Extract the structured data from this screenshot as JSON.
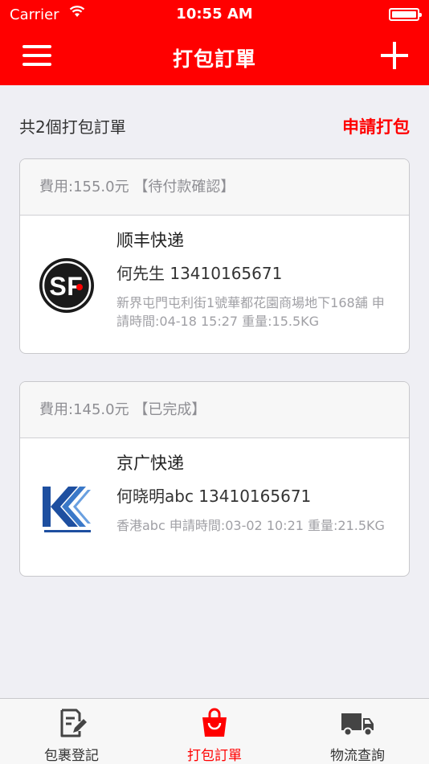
{
  "status_bar": {
    "carrier": "Carrier",
    "time": "10:55 AM"
  },
  "header": {
    "title": "打包訂單",
    "menu_icon": "hamburger-menu-icon",
    "add_icon": "plus-icon",
    "color": "#ff0000"
  },
  "summary": {
    "count_text": "共2個打包訂單",
    "apply_label": "申請打包"
  },
  "orders": [
    {
      "fee_status": "費用:155.0元 【待付款確認】",
      "courier": "顺丰快递",
      "contact": "何先生 13410165671",
      "detail": "新界屯門屯利街1號華都花園商場地下168舖 申請時間:04-18 15:27 重量:15.5KG",
      "logo": "sf-express-logo"
    },
    {
      "fee_status": "費用:145.0元 【已完成】",
      "courier": "京广快递",
      "contact": "何晓明abc 13410165671",
      "detail": "香港abc 申請時間:03-02 10:21 重量:21.5KG",
      "logo": "jingguang-express-logo"
    }
  ],
  "tabs": [
    {
      "label": "包裹登記",
      "icon": "document-edit-icon",
      "active": false
    },
    {
      "label": "打包訂單",
      "icon": "shopping-bag-icon",
      "active": true
    },
    {
      "label": "物流查詢",
      "icon": "truck-icon",
      "active": false
    }
  ]
}
